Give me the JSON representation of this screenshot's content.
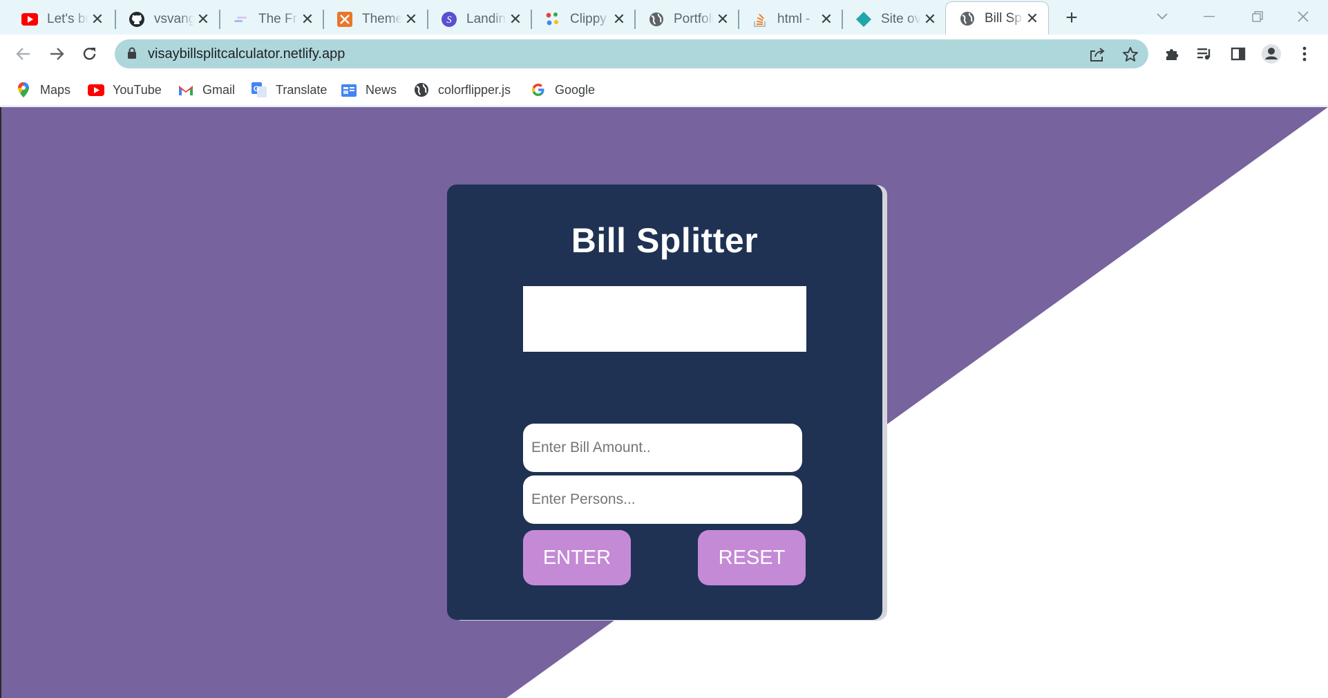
{
  "browser": {
    "tabs": [
      {
        "label": "Let's build",
        "icon": "youtube-icon",
        "active": false
      },
      {
        "label": "vsvangara",
        "icon": "github-icon",
        "active": false
      },
      {
        "label": "The Frontend",
        "icon": "frontend-mentor-icon",
        "active": false
      },
      {
        "label": "Themes",
        "icon": "theme-icon",
        "active": false
      },
      {
        "label": "Landing",
        "icon": "landing-icon",
        "active": false
      },
      {
        "label": "Clippy",
        "icon": "clippy-icon",
        "active": false
      },
      {
        "label": "Portfolio",
        "icon": "globe-icon",
        "active": false
      },
      {
        "label": "html -",
        "icon": "stackoverflow-icon",
        "active": false
      },
      {
        "label": "Site overview",
        "icon": "netlify-icon",
        "active": false
      },
      {
        "label": "Bill Splitter",
        "icon": "globe-icon",
        "active": true
      }
    ],
    "url": "visaybillsplitcalculator.netlify.app",
    "bookmarks": [
      {
        "label": "Maps",
        "icon": "maps-icon"
      },
      {
        "label": "YouTube",
        "icon": "youtube-icon"
      },
      {
        "label": "Gmail",
        "icon": "gmail-icon"
      },
      {
        "label": "Translate",
        "icon": "translate-icon"
      },
      {
        "label": "News",
        "icon": "news-icon"
      },
      {
        "label": "colorflipper.js",
        "icon": "globe-icon"
      },
      {
        "label": "Google",
        "icon": "google-icon"
      }
    ]
  },
  "app": {
    "title": "Bill Splitter",
    "result": "",
    "bill_amount": {
      "value": "",
      "placeholder": "Enter Bill Amount.."
    },
    "persons": {
      "value": "",
      "placeholder": "Enter Persons..."
    },
    "enter_label": "ENTER",
    "reset_label": "RESET"
  },
  "colors": {
    "background_purple": "#77639d",
    "card": "#1f3253",
    "button": "#c48ad6",
    "omnibox": "#aed7db",
    "tabstrip": "#e8f6fa"
  }
}
